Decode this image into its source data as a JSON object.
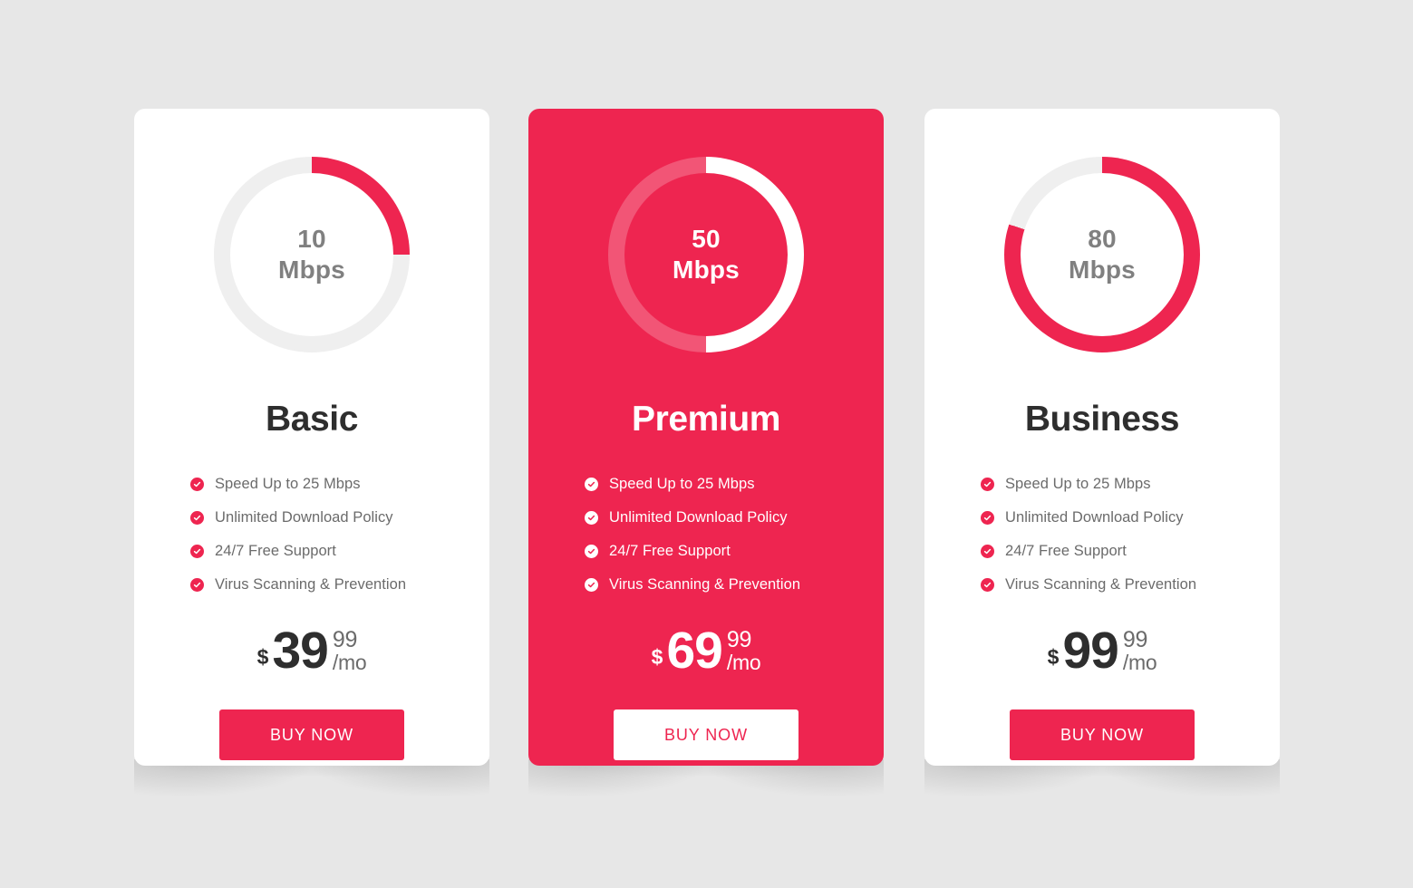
{
  "page": {
    "background_color": "#e7e7e7",
    "accent_color": "#ee2550"
  },
  "plans": [
    {
      "id": "basic",
      "featured": false,
      "gauge": {
        "value": "10",
        "unit": "Mbps",
        "percent": 25,
        "track_color": "#efefef",
        "progress_color": "#ee2550"
      },
      "title": "Basic",
      "features": [
        "Speed Up to 25 Mbps",
        "Unlimited Download Policy",
        "24/7 Free Support",
        "Virus Scanning & Prevention"
      ],
      "price": {
        "currency": "$",
        "amount": "39",
        "cents": "99",
        "period": "/mo"
      },
      "cta_label": "BUY NOW"
    },
    {
      "id": "premium",
      "featured": true,
      "gauge": {
        "value": "50",
        "unit": "Mbps",
        "percent": 50,
        "track_color": "#f4days",
        "progress_color": "#ffffff"
      },
      "title": "Premium",
      "features": [
        "Speed Up to 25 Mbps",
        "Unlimited Download Policy",
        "24/7 Free Support",
        "Virus Scanning & Prevention"
      ],
      "price": {
        "currency": "$",
        "amount": "69",
        "cents": "99",
        "period": "/mo"
      },
      "cta_label": "BUY NOW"
    },
    {
      "id": "business",
      "featured": false,
      "gauge": {
        "value": "80",
        "unit": "Mbps",
        "percent": 80,
        "track_color": "#efefef",
        "progress_color": "#ee2550"
      },
      "title": "Business",
      "features": [
        "Speed Up to 25 Mbps",
        "Unlimited Download Policy",
        "24/7 Free Support",
        "Virus Scanning & Prevention"
      ],
      "price": {
        "currency": "$",
        "amount": "99",
        "cents": "99",
        "period": "/mo"
      },
      "cta_label": "BUY NOW"
    }
  ]
}
